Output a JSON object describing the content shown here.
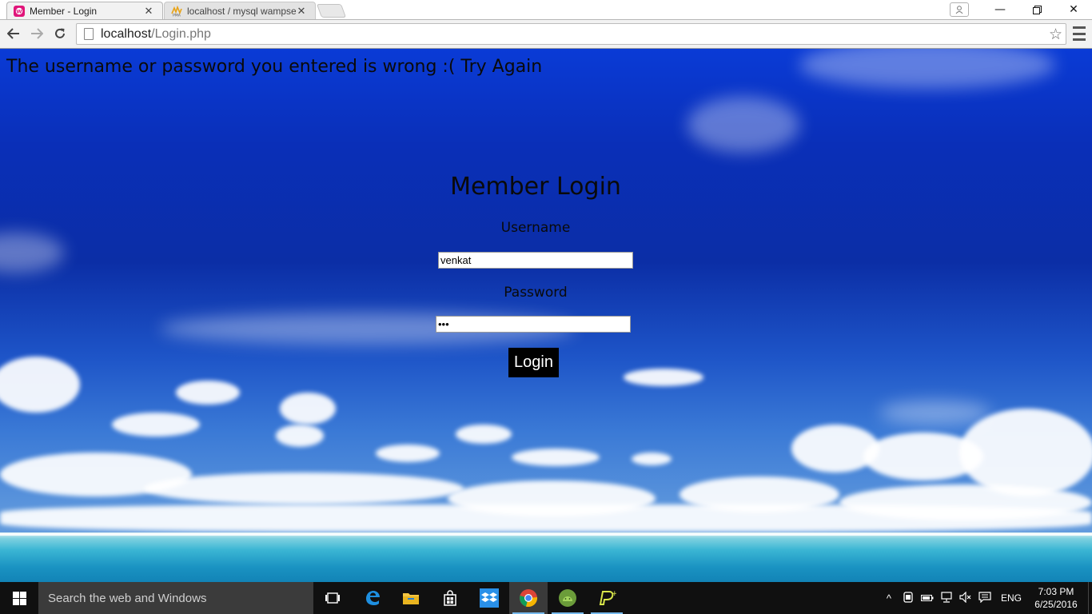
{
  "browser": {
    "tabs": [
      {
        "title": "Member - Login",
        "active": true
      },
      {
        "title": "localhost / mysql wampse",
        "active": false
      }
    ],
    "address": {
      "host": "localhost",
      "path": "/Login.php"
    }
  },
  "page": {
    "error": "The username or password you entered is wrong :( Try Again",
    "title": "Member Login",
    "username_label": "Username",
    "username_value": "venkat",
    "password_label": "Password",
    "password_value": "•••",
    "login_button": "Login"
  },
  "taskbar": {
    "search_placeholder": "Search the web and Windows",
    "language": "ENG",
    "time": "7:03 PM",
    "date": "6/25/2016"
  },
  "colors": {
    "sky": "#0a2fb8",
    "button_bg": "#000000",
    "taskbar": "#101010"
  }
}
